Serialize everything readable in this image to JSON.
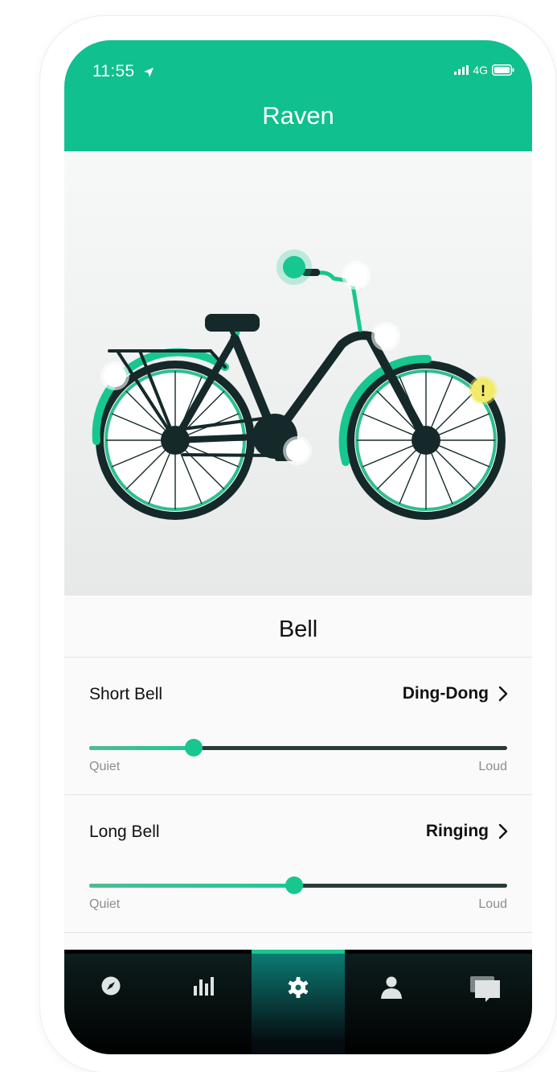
{
  "status_bar": {
    "time": "11:55",
    "network": "4G",
    "location_icon": "location-arrow-icon",
    "battery_icon": "battery-icon",
    "signal_icon": "signal-icon"
  },
  "header": {
    "title": "Raven"
  },
  "bike": {
    "hotspots": [
      {
        "name": "bell-hotspot",
        "state": "active"
      },
      {
        "name": "handlebar-hotspot",
        "state": "inactive"
      },
      {
        "name": "fork-hotspot",
        "state": "inactive"
      },
      {
        "name": "rear-rack-hotspot",
        "state": "inactive"
      },
      {
        "name": "pedal-hotspot",
        "state": "inactive"
      },
      {
        "name": "front-wheel-hotspot",
        "state": "warning",
        "symbol": "!"
      }
    ]
  },
  "section": {
    "title": "Bell"
  },
  "settings": [
    {
      "label": "Short Bell",
      "value": "Ding-Dong",
      "level": 0.25,
      "min_label": "Quiet",
      "max_label": "Loud"
    },
    {
      "label": "Long Bell",
      "value": "Ringing",
      "level": 0.49,
      "min_label": "Quiet",
      "max_label": "Loud"
    }
  ],
  "tabs": [
    {
      "name": "explore",
      "icon": "compass-icon",
      "active": false
    },
    {
      "name": "stats",
      "icon": "bar-chart-icon",
      "active": false
    },
    {
      "name": "settings",
      "icon": "gear-icon",
      "active": true
    },
    {
      "name": "profile",
      "icon": "person-icon",
      "active": false
    },
    {
      "name": "messages",
      "icon": "chat-icon",
      "active": false
    }
  ],
  "colors": {
    "accent": "#10c08e",
    "dark": "#15292a",
    "warning": "#f2ea6b",
    "tabbar": "#000000"
  }
}
